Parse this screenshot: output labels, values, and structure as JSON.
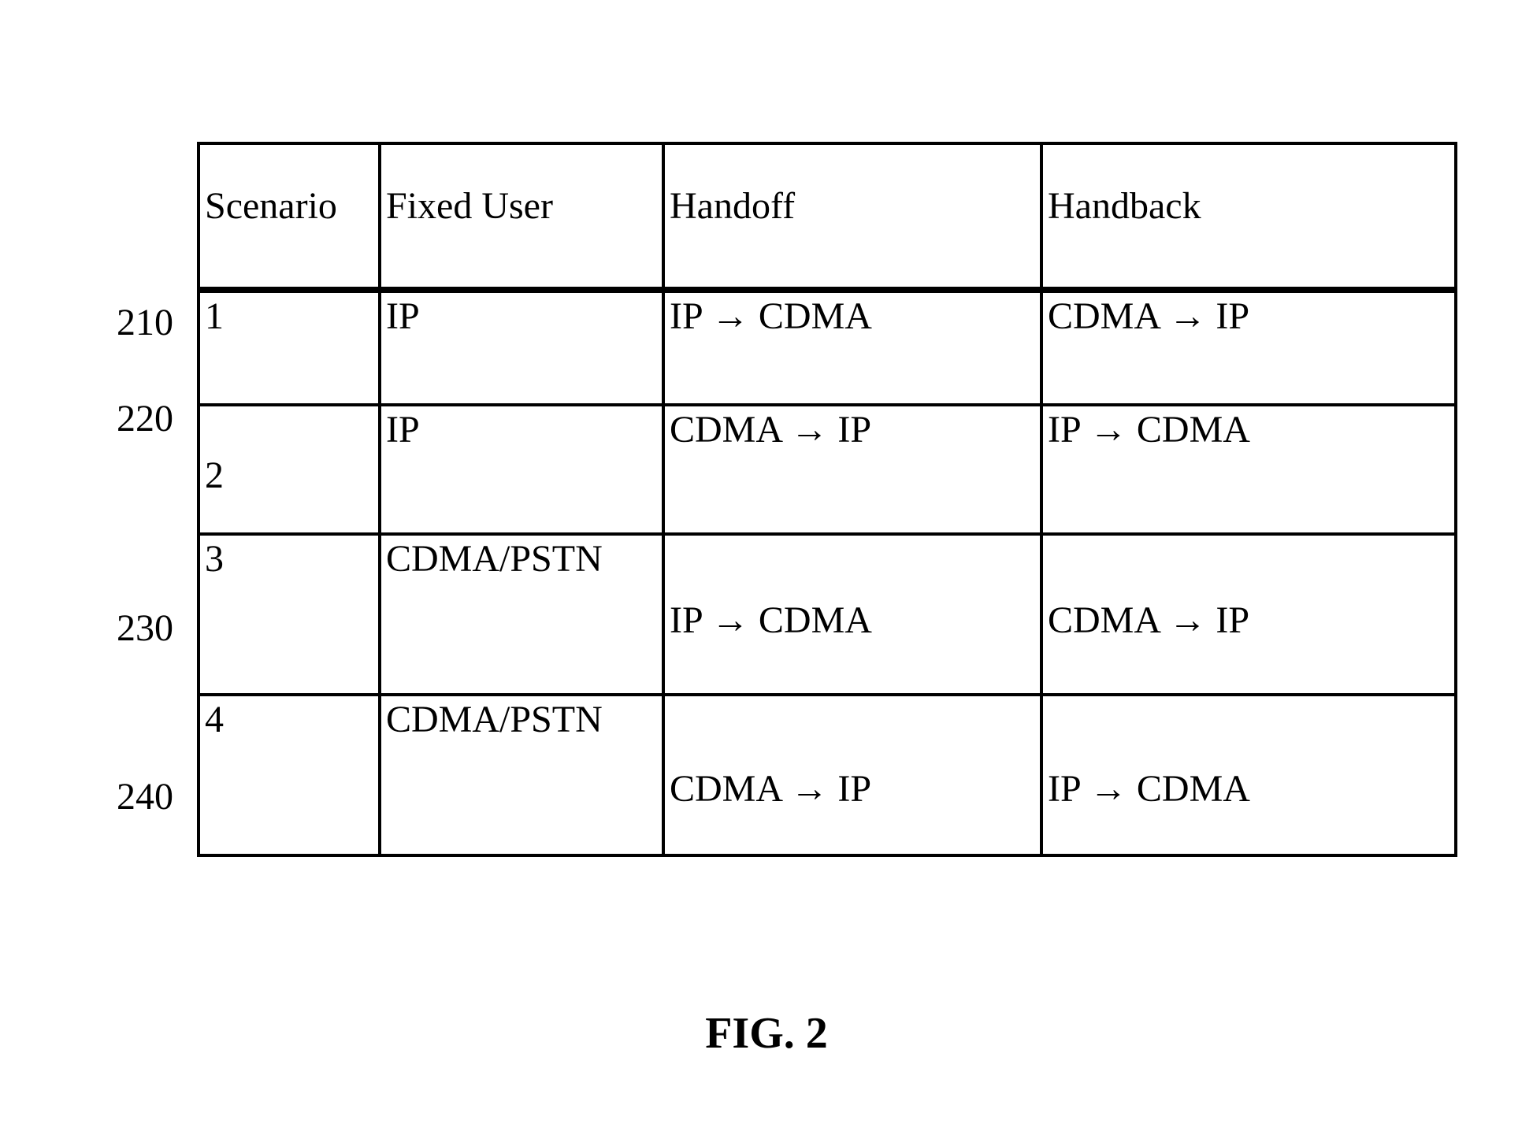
{
  "caption": "FIG. 2",
  "headers": {
    "scenario": "Scenario",
    "fixed_user": "Fixed User",
    "handoff": "Handoff",
    "handback": "Handback"
  },
  "rows": [
    {
      "label": "210",
      "scenario": "1",
      "fixed_user": "IP",
      "handoff": "IP → CDMA",
      "handback": "CDMA → IP"
    },
    {
      "label": "220",
      "scenario": "2",
      "fixed_user": "IP",
      "handoff": "CDMA → IP",
      "handback": "IP → CDMA"
    },
    {
      "label": "230",
      "scenario": "3",
      "fixed_user": "CDMA/PSTN",
      "handoff": "IP → CDMA",
      "handback": "CDMA → IP"
    },
    {
      "label": "240",
      "scenario": "4",
      "fixed_user": "CDMA/PSTN",
      "handoff": "CDMA → IP",
      "handback": "IP → CDMA"
    }
  ],
  "chart_data": {
    "type": "table",
    "title": "FIG. 2",
    "columns": [
      "Scenario",
      "Fixed User",
      "Handoff",
      "Handback"
    ],
    "row_labels": [
      "210",
      "220",
      "230",
      "240"
    ],
    "rows": [
      [
        "1",
        "IP",
        "IP → CDMA",
        "CDMA → IP"
      ],
      [
        "2",
        "IP",
        "CDMA → IP",
        "IP → CDMA"
      ],
      [
        "3",
        "CDMA/PSTN",
        "IP → CDMA",
        "CDMA → IP"
      ],
      [
        "4",
        "CDMA/PSTN",
        "CDMA → IP",
        "IP → CDMA"
      ]
    ]
  }
}
